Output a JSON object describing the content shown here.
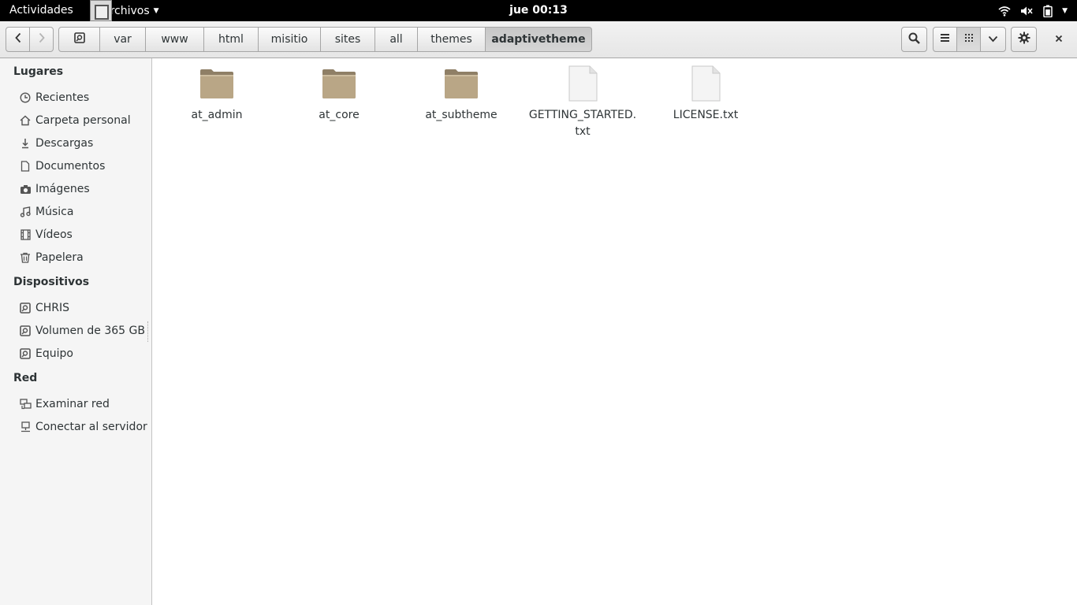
{
  "topbar": {
    "activities": "Actividades",
    "app_name": "Archivos",
    "clock": "jue 00:13",
    "status_icons": [
      "wifi-icon",
      "volume-icon",
      "battery-icon"
    ]
  },
  "header": {
    "back_icon": "chevron-left-icon",
    "forward_icon": "chevron-right-icon",
    "location_root_icon": "drive-icon",
    "breadcrumbs": [
      "var",
      "www",
      "html",
      "misitio",
      "sites",
      "all",
      "themes",
      "adaptivetheme"
    ],
    "search_icon": "search-icon",
    "list_view_icon": "list-icon",
    "grid_view_icon": "grid-icon",
    "view_options_icon": "chevron-down-icon",
    "settings_icon": "gear-icon",
    "close_icon": "close-icon"
  },
  "sidebar": {
    "places_heading": "Lugares",
    "places": [
      {
        "label": "Recientes",
        "icon": "clock-icon"
      },
      {
        "label": "Carpeta personal",
        "icon": "home-icon"
      },
      {
        "label": "Descargas",
        "icon": "download-icon"
      },
      {
        "label": "Documentos",
        "icon": "document-icon"
      },
      {
        "label": "Imágenes",
        "icon": "camera-icon"
      },
      {
        "label": "Música",
        "icon": "music-icon"
      },
      {
        "label": "Vídeos",
        "icon": "film-icon"
      },
      {
        "label": "Papelera",
        "icon": "trash-icon"
      }
    ],
    "devices_heading": "Dispositivos",
    "devices": [
      {
        "label": "CHRIS",
        "icon": "drive-icon"
      },
      {
        "label": "Volumen de 365 GB",
        "icon": "drive-icon"
      },
      {
        "label": "Equipo",
        "icon": "drive-icon"
      }
    ],
    "network_heading": "Red",
    "network": [
      {
        "label": "Examinar red",
        "icon": "network-icon"
      },
      {
        "label": "Conectar al servidor",
        "icon": "server-icon"
      }
    ]
  },
  "files": [
    {
      "name": "at_admin",
      "type": "folder"
    },
    {
      "name": "at_core",
      "type": "folder"
    },
    {
      "name": "at_subtheme",
      "type": "folder"
    },
    {
      "name": "GETTING_STARTED.txt",
      "type": "text"
    },
    {
      "name": "LICENSE.txt",
      "type": "text"
    }
  ],
  "colors": {
    "topbar_bg": "#000000",
    "folder": "#b5a182",
    "selected_crumb": "#c7c7c7"
  }
}
